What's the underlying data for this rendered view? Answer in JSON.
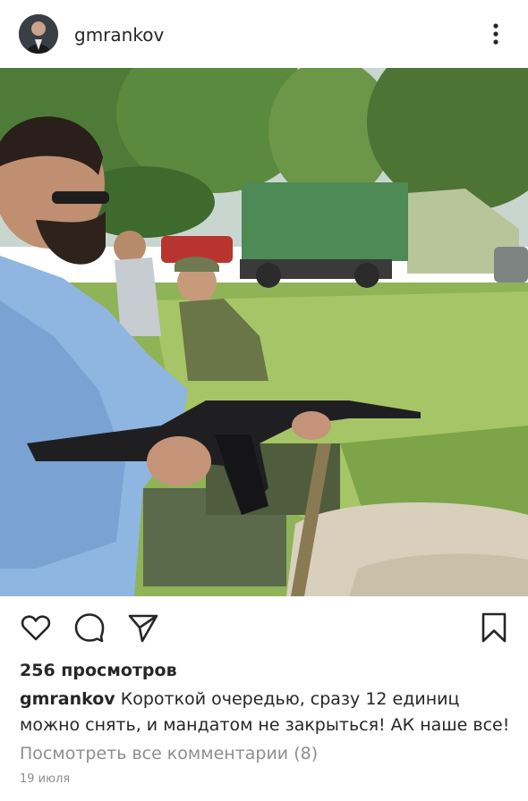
{
  "post": {
    "username": "gmrankov",
    "views": "256 просмотров",
    "caption_user": "gmrankov",
    "caption_text": "Короткой очередью, сразу 12 единиц можно снять, и мандатом не закрыться! АК наше все!",
    "view_comments": "Посмотреть все комментарии (8)",
    "date": "19 июля"
  },
  "icons": {
    "more": "more-vertical-icon",
    "like": "heart-icon",
    "comment": "comment-icon",
    "share": "send-icon",
    "save": "bookmark-icon"
  },
  "colors": {
    "text": "#262626",
    "muted": "#8e8e8e",
    "background": "#ffffff"
  }
}
